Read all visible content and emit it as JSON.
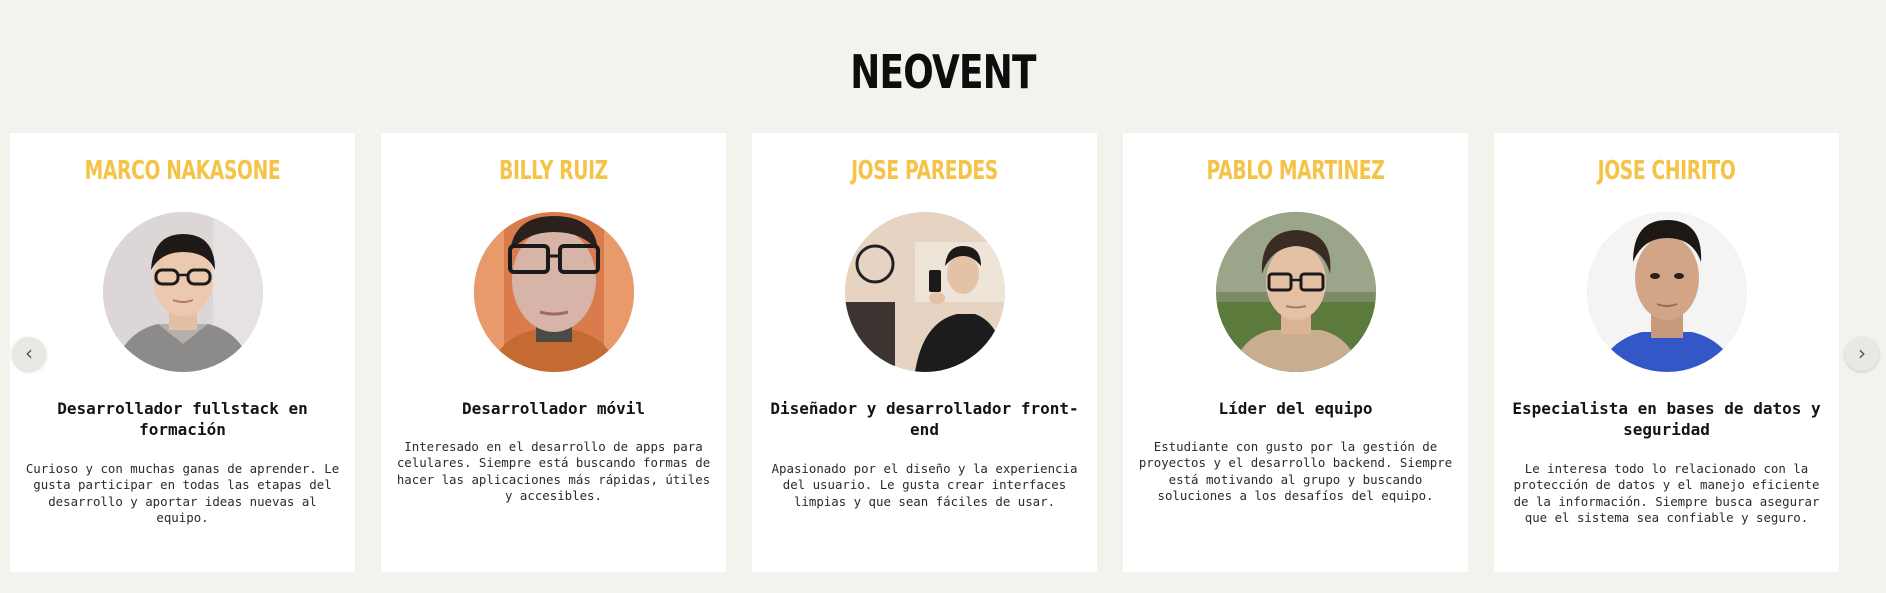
{
  "page": {
    "title": "NEOVENT"
  },
  "carousel": {
    "prev_icon": "‹",
    "next_icon": "›"
  },
  "members": [
    {
      "name": "MARCO NAKASONE",
      "role": "Desarrollador fullstack en formación",
      "description": "Curioso y con muchas ganas de aprender. Le gusta participar en todas las etapas del desarrollo y aportar ideas nuevas al equipo."
    },
    {
      "name": "BILLY RUIZ",
      "role": "Desarrollador móvil",
      "description": "Interesado en el desarrollo de apps para celulares. Siempre está buscando formas de hacer las aplicaciones más rápidas, útiles y accesibles."
    },
    {
      "name": "JOSE PAREDES",
      "role": "Diseñador y desarrollador front-end",
      "description": "Apasionado por el diseño y la experiencia del usuario. Le gusta crear interfaces limpias y que sean fáciles de usar."
    },
    {
      "name": "PABLO MARTINEZ",
      "role": "Líder del equipo",
      "description": "Estudiante con gusto por la gestión de proyectos y el desarrollo backend. Siempre está motivando al grupo y buscando soluciones a los desafíos del equipo."
    },
    {
      "name": "JOSE CHIRITO",
      "role": "Especialista en bases de datos y seguridad",
      "description": "Le interesa todo lo relacionado con la protección de datos y el manejo eficiente de la información. Siempre busca asegurar que el sistema sea confiable y seguro."
    }
  ],
  "colors": {
    "background": "#f3f3ee",
    "card": "#ffffff",
    "accent_name": "#f5c348"
  }
}
